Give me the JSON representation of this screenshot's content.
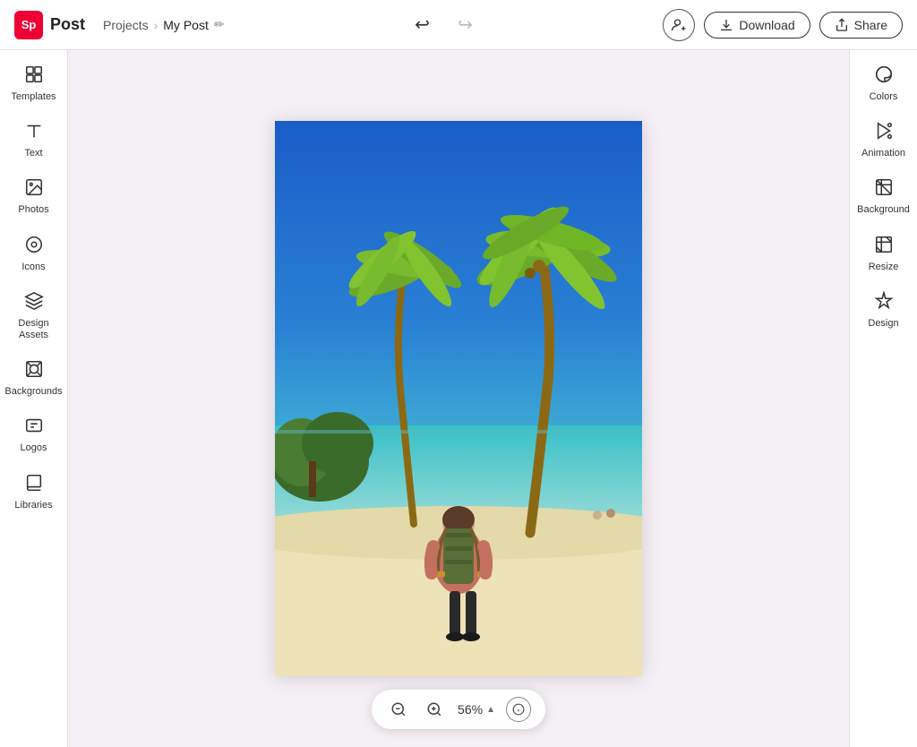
{
  "app": {
    "logo_text": "Sp",
    "name": "Post",
    "brand_color": "#ee0033"
  },
  "header": {
    "breadcrumb_projects": "Projects",
    "breadcrumb_sep": "›",
    "breadcrumb_current": "My Post",
    "download_label": "Download",
    "share_label": "Share"
  },
  "left_sidebar": {
    "items": [
      {
        "id": "templates",
        "label": "Templates",
        "icon": "templates"
      },
      {
        "id": "text",
        "label": "Text",
        "icon": "text"
      },
      {
        "id": "photos",
        "label": "Photos",
        "icon": "photos"
      },
      {
        "id": "icons",
        "label": "Icons",
        "icon": "icons"
      },
      {
        "id": "design-assets",
        "label": "Design Assets",
        "icon": "design-assets"
      },
      {
        "id": "backgrounds",
        "label": "Backgrounds",
        "icon": "backgrounds"
      },
      {
        "id": "logos",
        "label": "Logos",
        "icon": "logos"
      },
      {
        "id": "libraries",
        "label": "Libraries",
        "icon": "libraries"
      }
    ]
  },
  "right_sidebar": {
    "items": [
      {
        "id": "colors",
        "label": "Colors",
        "icon": "colors"
      },
      {
        "id": "animation",
        "label": "Animation",
        "icon": "animation"
      },
      {
        "id": "background",
        "label": "Background",
        "icon": "background"
      },
      {
        "id": "resize",
        "label": "Resize",
        "icon": "resize"
      },
      {
        "id": "design",
        "label": "Design",
        "icon": "design"
      }
    ]
  },
  "zoom": {
    "value": "56%",
    "zoom_out_label": "zoom-out",
    "zoom_in_label": "zoom-in"
  }
}
